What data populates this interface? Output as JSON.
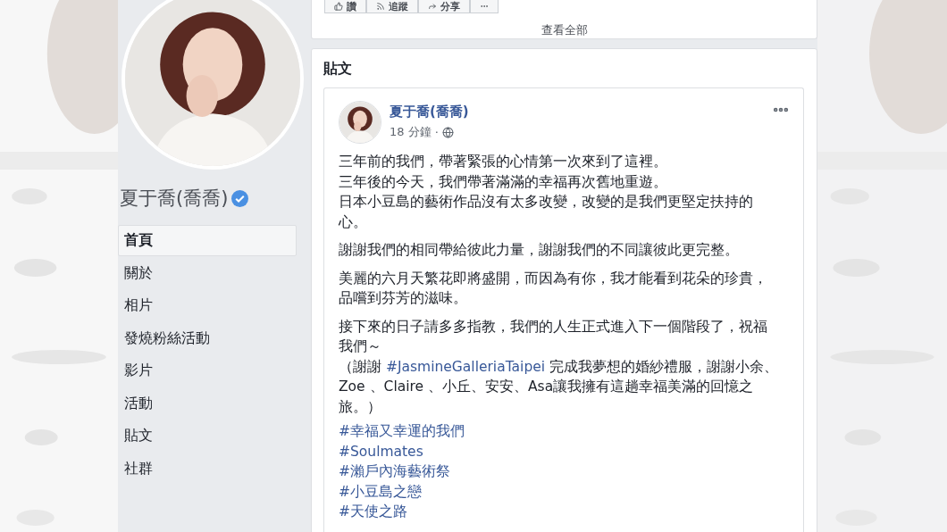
{
  "page": {
    "name": "夏于喬(喬喬)",
    "verified": true
  },
  "sidebar": {
    "items": [
      {
        "label": "首頁",
        "selected": true
      },
      {
        "label": "關於",
        "selected": false
      },
      {
        "label": "相片",
        "selected": false
      },
      {
        "label": "發燒粉絲活動",
        "selected": false
      },
      {
        "label": "影片",
        "selected": false
      },
      {
        "label": "活動",
        "selected": false
      },
      {
        "label": "貼文",
        "selected": false
      },
      {
        "label": "社群",
        "selected": false
      }
    ]
  },
  "actions": [
    {
      "kind": "like",
      "label": "讚"
    },
    {
      "kind": "follow",
      "label": "追蹤"
    },
    {
      "kind": "share",
      "label": "分享"
    },
    {
      "kind": "more"
    }
  ],
  "see_all": "查看全部",
  "posts_section": {
    "title": "貼文",
    "post": {
      "author": "夏于喬(喬喬)",
      "time": "18 分鐘",
      "separator": "·",
      "paragraphs": [
        {
          "lines": [
            [
              {
                "kind": "text",
                "text": "三年前的我們，帶著緊張的心情第一次來到了這裡。"
              }
            ],
            [
              {
                "kind": "text",
                "text": "三年後的今天，我們帶著滿滿的幸福再次舊地重遊。"
              }
            ],
            [
              {
                "kind": "text",
                "text": "日本小豆島的藝術作品沒有太多改變，改變的是我們更堅定扶持的心。"
              }
            ]
          ]
        },
        {
          "lines": [
            [
              {
                "kind": "text",
                "text": "謝謝我們的相同帶給彼此力量，謝謝我們的不同讓彼此更完整。"
              }
            ]
          ]
        },
        {
          "lines": [
            [
              {
                "kind": "text",
                "text": "美麗的六月天繁花即將盛開，而因為有你，我才能看到花朵的珍貴，品嚐到芬芳的滋味。"
              }
            ]
          ]
        },
        {
          "lines": [
            [
              {
                "kind": "text",
                "text": "接下來的日子請多多指教，我們的人生正式進入下一個階段了，祝福我們～"
              }
            ],
            [
              {
                "kind": "text",
                "text": "（謝謝 "
              },
              {
                "kind": "hashtag",
                "text": "#JasmineGalleriaTaipei"
              },
              {
                "kind": "text",
                "text": " 完成我夢想的婚紗禮服，謝謝小余、Zoe 、Claire 、小丘、安安、Asa讓我擁有這趟幸福美滿的回憶之旅。）"
              }
            ]
          ]
        }
      ],
      "hashtags": [
        "#幸福又幸運的我們",
        "#Soulmates",
        "#瀨戶內海藝術祭",
        "#小豆島之戀",
        "#天使之路"
      ]
    }
  }
}
